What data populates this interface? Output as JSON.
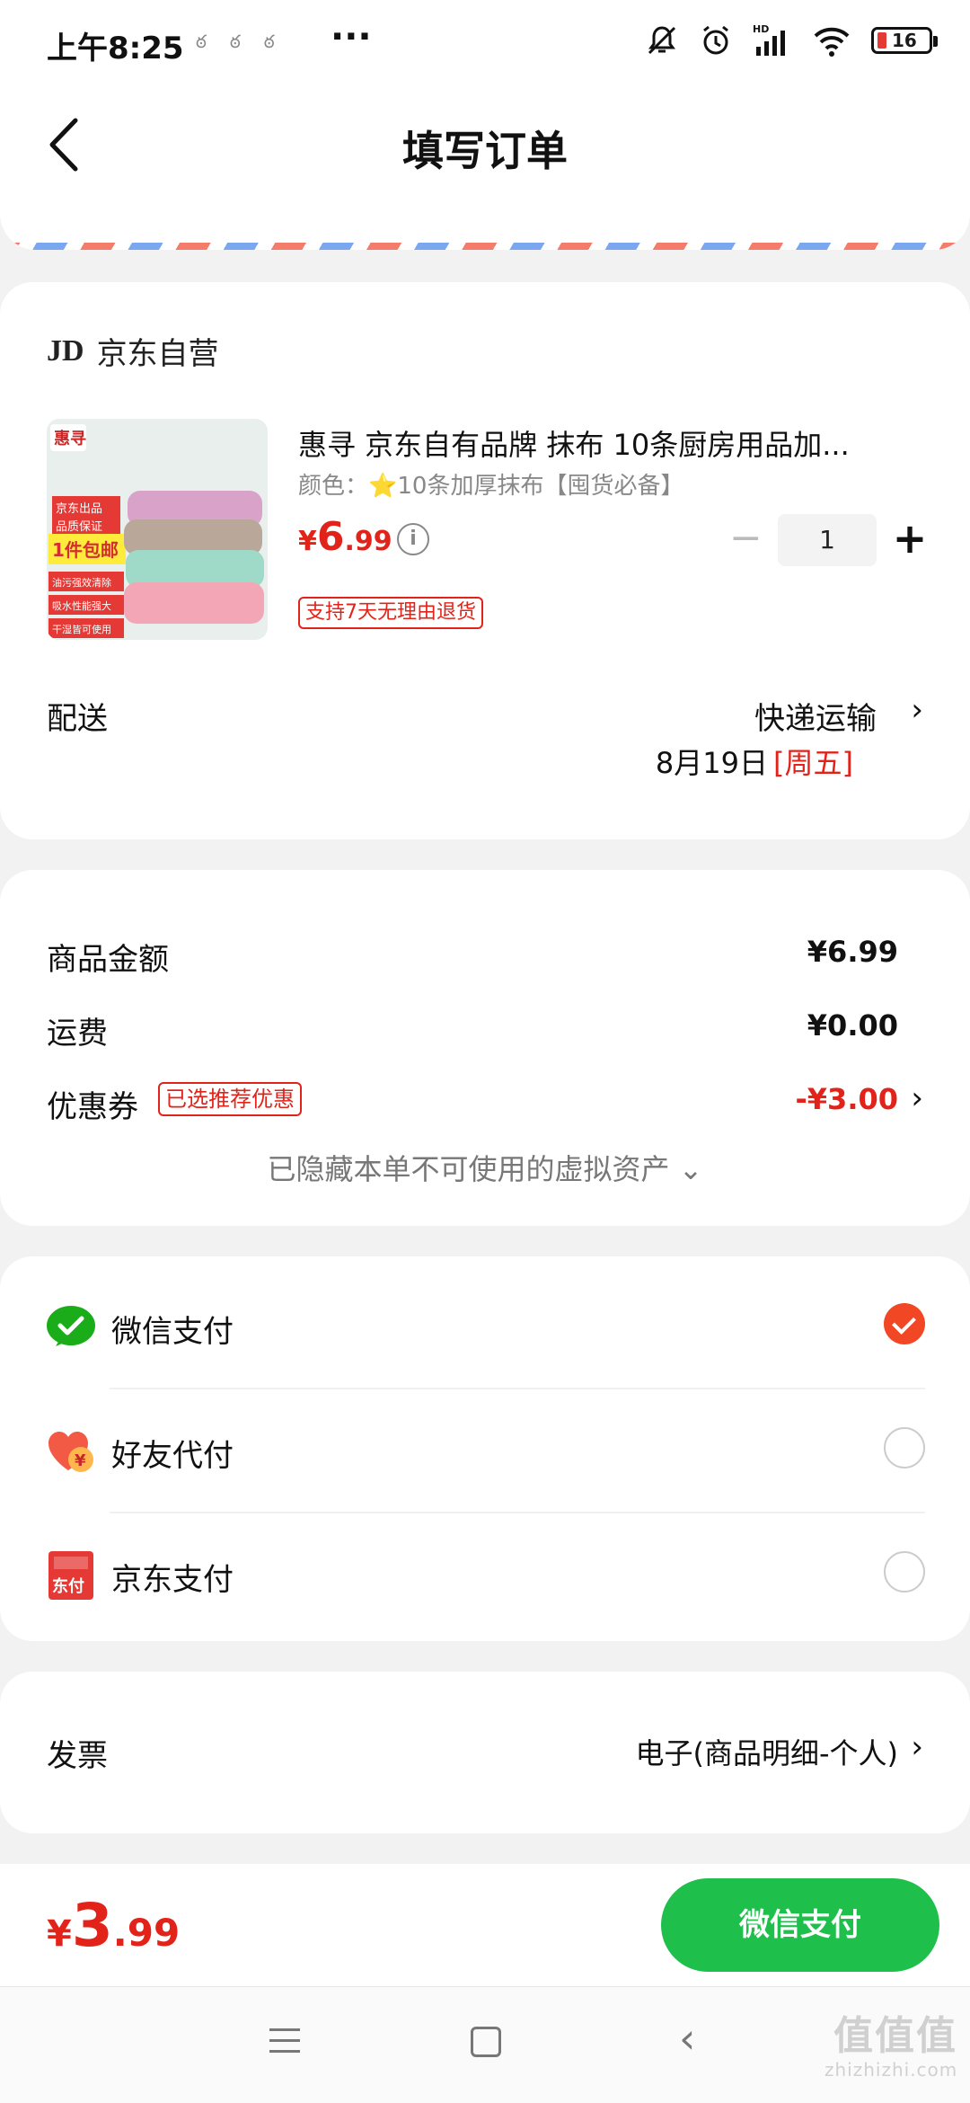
{
  "status_bar": {
    "time": "上午8:25",
    "battery": "16"
  },
  "header": {
    "title": "填写订单"
  },
  "order": {
    "shop": {
      "logo": "JD",
      "name": "京东自营"
    },
    "product": {
      "title": "惠寻 京东自有品牌 抹布 10条厨房用品加...",
      "variant": "颜色：⭐10条加厚抹布【囤货必备】",
      "price_currency": "¥",
      "price_int": "6",
      "price_dec": ".99",
      "quantity": "1",
      "return_policy": "支持7天无理由退货",
      "image_labels": {
        "brand": "惠寻",
        "tag1": "京东出品",
        "tag2": "品质保证",
        "promo": "1件包邮",
        "feature1": "油污强效清除",
        "feature2": "吸水性能强大",
        "feature3": "干湿皆可使用"
      }
    },
    "delivery": {
      "label": "配送",
      "method": "快递运输",
      "date": "8月19日",
      "weekday": "[周五]"
    }
  },
  "amounts": {
    "goods_label": "商品金额",
    "goods_value": "¥6.99",
    "shipping_label": "运费",
    "shipping_value": "¥0.00",
    "coupon_label": "优惠券",
    "coupon_badge": "已选推荐优惠",
    "coupon_value": "-¥3.00",
    "hidden_assets": "已隐藏本单不可使用的虚拟资产 ⌄"
  },
  "payment": {
    "methods": [
      {
        "label": "微信支付",
        "icon": "wechat-pay-icon",
        "selected": true
      },
      {
        "label": "好友代付",
        "icon": "friend-pay-icon",
        "selected": false
      },
      {
        "label": "京东支付",
        "icon": "jd-pay-icon",
        "selected": false
      }
    ],
    "jd_pay_icon_text": "东付"
  },
  "invoice": {
    "label": "发票",
    "value": "电子(商品明细-个人)"
  },
  "footer": {
    "total_currency": "¥",
    "total_int": "3",
    "total_dec": ".99",
    "submit_label": "微信支付"
  },
  "watermark": {
    "main": "值值值",
    "sub": "zhizhizhi.com"
  },
  "colors": {
    "accent_red": "#e2231a",
    "wechat_green": "#1ec04b",
    "check_orange": "#f24724"
  }
}
